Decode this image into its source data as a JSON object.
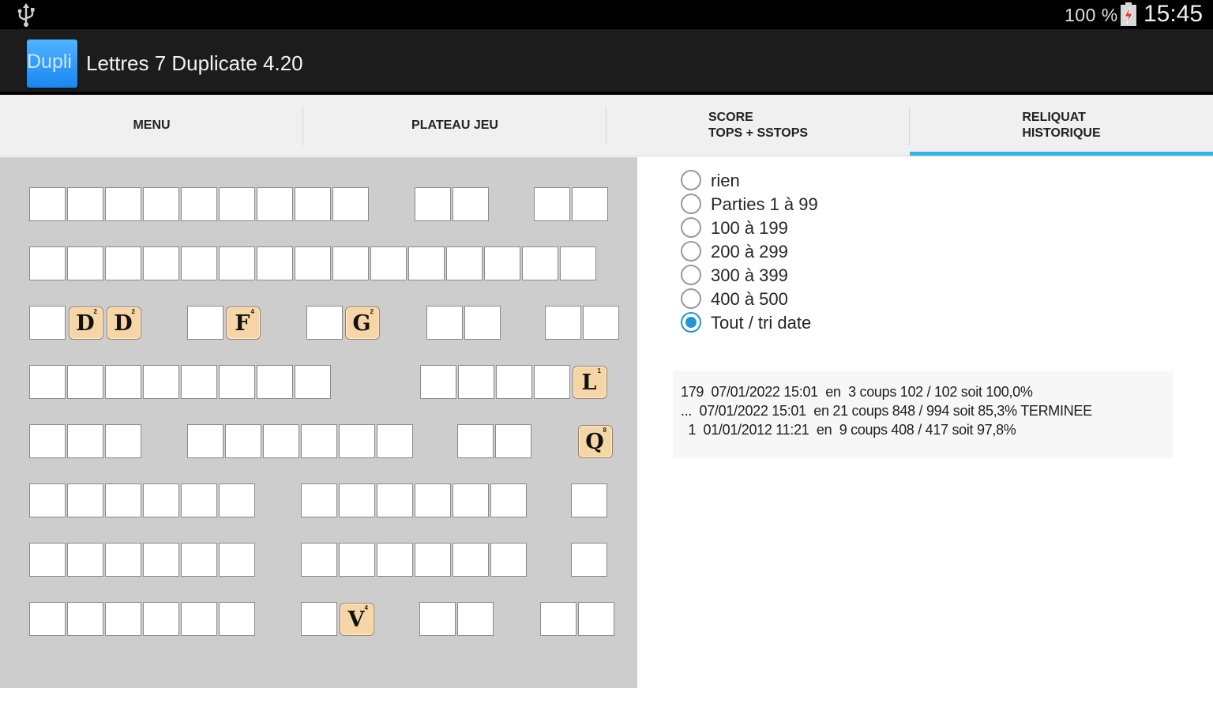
{
  "status_bar": {
    "usb_icon": "usb-icon",
    "battery_percent": "100 %",
    "battery_icon": "battery-charging-icon",
    "time": "15:45"
  },
  "action_bar": {
    "app_icon_text": "Dupli",
    "title": "Lettres 7 Duplicate 4.20"
  },
  "tabs": [
    {
      "line1": "MENU",
      "line2": ""
    },
    {
      "line1": "PLATEAU JEU",
      "line2": ""
    },
    {
      "line1": "SCORE",
      "line2": "TOPS + SSTOPS"
    },
    {
      "line1": "RELIQUAT",
      "line2": "HISTORIQUE",
      "active": true
    }
  ],
  "board": {
    "tiles": [
      {
        "letter": "D",
        "points": "2"
      },
      {
        "letter": "D",
        "points": "2"
      },
      {
        "letter": "F",
        "points": "4"
      },
      {
        "letter": "G",
        "points": "2"
      },
      {
        "letter": "L",
        "points": "1"
      },
      {
        "letter": "Q",
        "points": "8"
      },
      {
        "letter": "V",
        "points": "4"
      }
    ]
  },
  "filter_options": [
    {
      "label": "rien",
      "selected": false
    },
    {
      "label": "Parties 1 à 99",
      "selected": false
    },
    {
      "label": "100 à 199",
      "selected": false
    },
    {
      "label": "200 à 299",
      "selected": false
    },
    {
      "label": "300 à 399",
      "selected": false
    },
    {
      "label": "400 à 500",
      "selected": false
    },
    {
      "label": "Tout / tri date",
      "selected": true
    }
  ],
  "history": [
    "179  07/01/2022 15:01  en  3 coups 102 / 102 soit 100,0%",
    "...  07/01/2022 15:01  en 21 coups 848 / 994 soit 85,3% TERMINEE",
    "  1  01/01/2012 11:21  en  9 coups 408 / 417 soit 97,8%"
  ],
  "colors": {
    "accent": "#33b5e5",
    "tile": "#f6d6a6",
    "board_bg": "#cdcdcd"
  }
}
